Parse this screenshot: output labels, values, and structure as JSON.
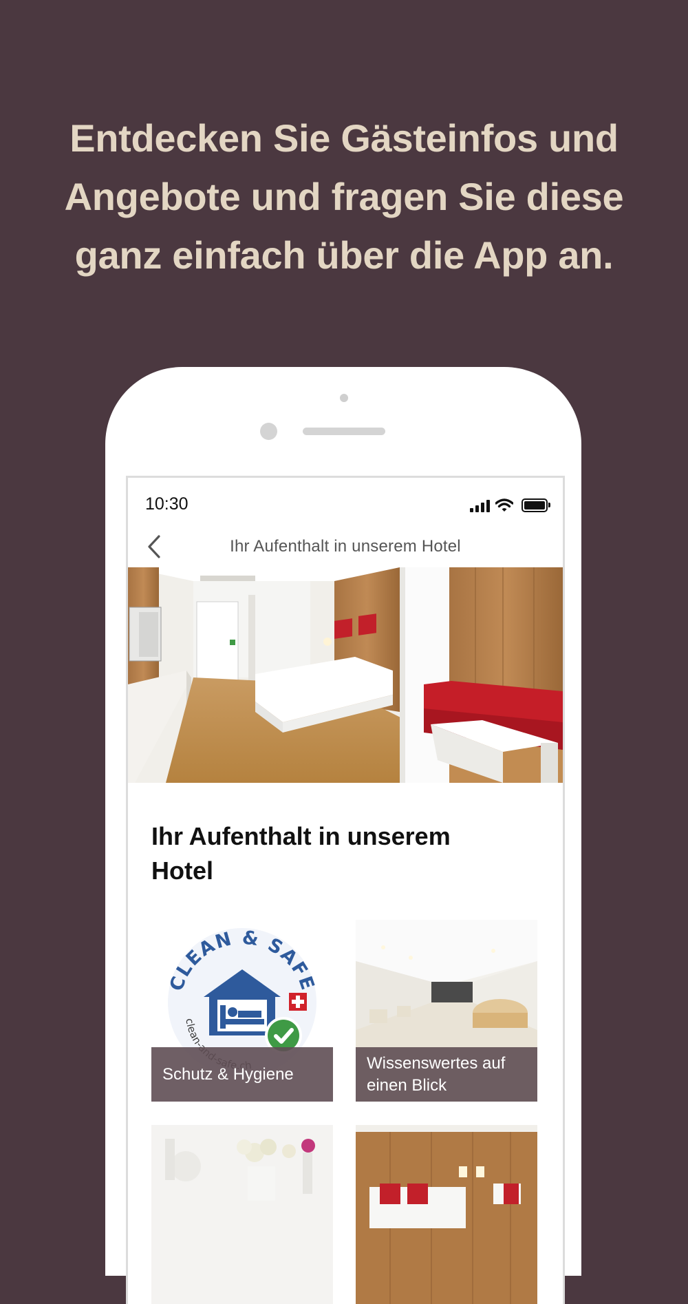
{
  "headline": {
    "line1": "Entdecken Sie Gästeinfos und",
    "line2": "Angebote und fragen Sie diese",
    "line3": "ganz einfach über die App an."
  },
  "status_bar": {
    "time": "10:30"
  },
  "nav": {
    "title": "Ihr Aufenthalt in unserem Hotel",
    "back_icon": "chevron-left-icon"
  },
  "section": {
    "title_line1": "Ihr Aufenthalt in unserem",
    "title_line2": "Hotel"
  },
  "tiles": [
    {
      "caption": "Schutz & Hygiene",
      "logo": {
        "top": "CLEAN & SAFE",
        "bottom": "clean-and-safe.ch"
      }
    },
    {
      "caption_line1": "Wissenswertes auf",
      "caption_line2": "einen Blick"
    },
    {
      "caption": ""
    },
    {
      "caption": ""
    }
  ],
  "colors": {
    "background": "#4b3840",
    "headline": "#e3d6c3",
    "caption_overlay": "#5f4e54",
    "logo_blue": "#2e5a9c",
    "swiss_red": "#d0222b",
    "check_green": "#3f9a45"
  }
}
